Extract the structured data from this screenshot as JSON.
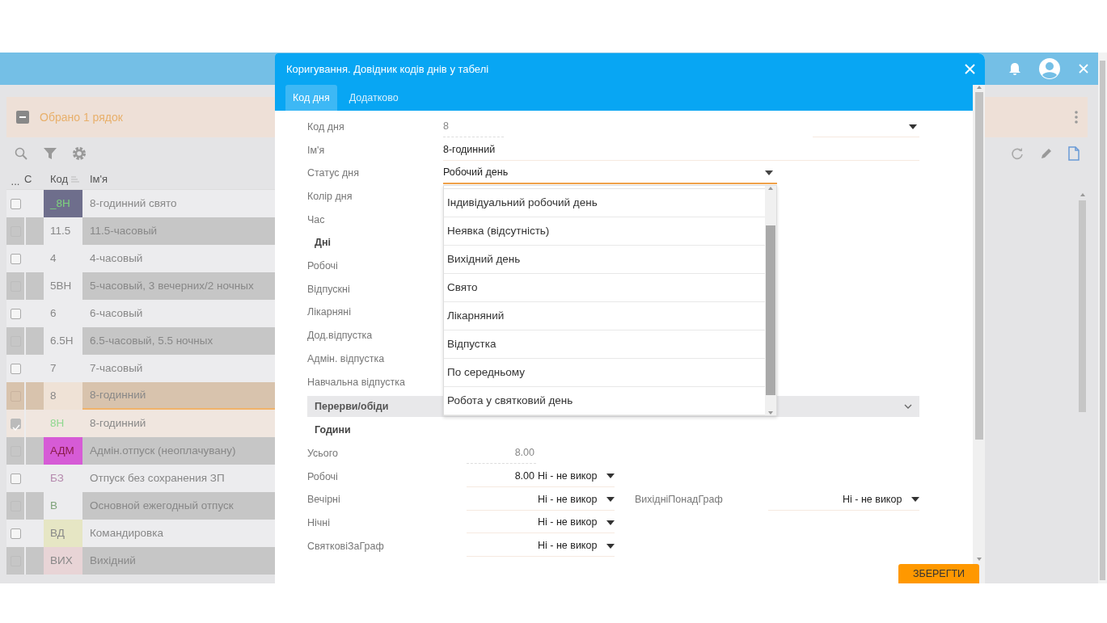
{
  "selection_bar": {
    "text": "Обрано 1 рядок"
  },
  "grid": {
    "columns": [
      "...",
      "С",
      "Код",
      "Ім'я"
    ],
    "rows": [
      {
        "code": {
          "text": "_8Н",
          "color": "#7ed47e"
        },
        "name": "8-годинний свято",
        "checked": false,
        "current": false,
        "color": "#6e6e8c"
      },
      {
        "code": {
          "text": "11.5"
        },
        "name": "11.5-часовый",
        "checked": false,
        "current": false
      },
      {
        "code": {
          "text": "4"
        },
        "name": "4-часовый",
        "checked": false,
        "current": false
      },
      {
        "code": {
          "text": "5ВН"
        },
        "name": "5-часовый, 3 вечерних/2 ночных",
        "checked": false,
        "current": false
      },
      {
        "code": {
          "text": "6"
        },
        "name": "6-часовый",
        "checked": false,
        "current": false
      },
      {
        "code": {
          "text": "6.5Н"
        },
        "name": "6.5-часовый, 5.5 ночных",
        "checked": false,
        "current": false
      },
      {
        "code": {
          "text": "7"
        },
        "name": "7-часовый",
        "checked": false,
        "current": false
      },
      {
        "code": {
          "text": "8"
        },
        "name": "8-годинний",
        "checked": false,
        "current": true
      },
      {
        "code": {
          "text": "8Н",
          "color": "#8fd88f"
        },
        "name": "8-годинний",
        "checked": true,
        "current": false
      },
      {
        "code": {
          "text": "АДМ",
          "color": "#8a1c4a"
        },
        "name": "Адмін.отпуск (неоплачувану)",
        "checked": false,
        "current": false,
        "color": "#d65bd6"
      },
      {
        "code": {
          "text": "БЗ",
          "color": "#b589ad"
        },
        "name": "Отпуск без сохранения ЗП",
        "checked": false,
        "current": false
      },
      {
        "code": {
          "text": "В",
          "color": "#7fa37a"
        },
        "name": "Основной ежегодный отпуск",
        "checked": false,
        "current": false
      },
      {
        "code": {
          "text": "ВД"
        },
        "name": "Командировка",
        "checked": false,
        "current": false,
        "color": "#e6e6c4"
      },
      {
        "code": {
          "text": "ВИХ"
        },
        "name": "Вихідний",
        "checked": false,
        "current": false,
        "color": "#e8d4d6"
      }
    ]
  },
  "dialog": {
    "title": "Коригування. Довідник кодів днів у табелі",
    "tabs": [
      {
        "label": "Код дня",
        "selected": true
      },
      {
        "label": "Додатково",
        "selected": false
      }
    ],
    "fields": [
      {
        "kind": "combo",
        "label": "Код дня",
        "value": "8"
      },
      {
        "kind": "text",
        "label": "Ім'я",
        "value": "8-годинний"
      },
      {
        "kind": "select",
        "label": "Статус дня",
        "value": "Робочий день",
        "open": true
      },
      {
        "kind": "label",
        "label": "Колір дня"
      },
      {
        "kind": "label",
        "label": "Час"
      },
      {
        "kind": "heading",
        "label": "Дні"
      },
      {
        "kind": "label",
        "label": "Робочі"
      },
      {
        "kind": "label",
        "label": "Відпускні"
      },
      {
        "kind": "label",
        "label": "Лікарняні"
      },
      {
        "kind": "label",
        "label": "Дод.відпустка"
      },
      {
        "kind": "label",
        "label": "Адмін. відпустка"
      },
      {
        "kind": "label",
        "label": "Навчальна відпустка"
      },
      {
        "kind": "section",
        "label": "Перерви/обіди",
        "expanded": false
      },
      {
        "kind": "heading",
        "label": "Години"
      }
    ],
    "dropdown_items": [
      "Індивідуальний робочий день",
      "Неявка (відсутність)",
      "Вихідний день",
      "Свято",
      "Лікарняний",
      "Відпустка",
      "По середньому",
      "Робота у святковий день"
    ],
    "hours": [
      {
        "label": "Усього",
        "value": "8.00"
      },
      {
        "label": "Робочі",
        "value": "8.00",
        "option": "Ні - не викор"
      },
      {
        "label": "Вечірні",
        "option": "Ні - не викор",
        "side": {
          "label": "ВихідніПонадГраф",
          "option": "Ні - не викор"
        }
      },
      {
        "label": "Нічні",
        "option": "Ні - не викор"
      },
      {
        "label": "СвятковіЗаГраф",
        "option": "Ні - не викор"
      }
    ],
    "save_button": "ЗБЕРЕГТИ"
  }
}
